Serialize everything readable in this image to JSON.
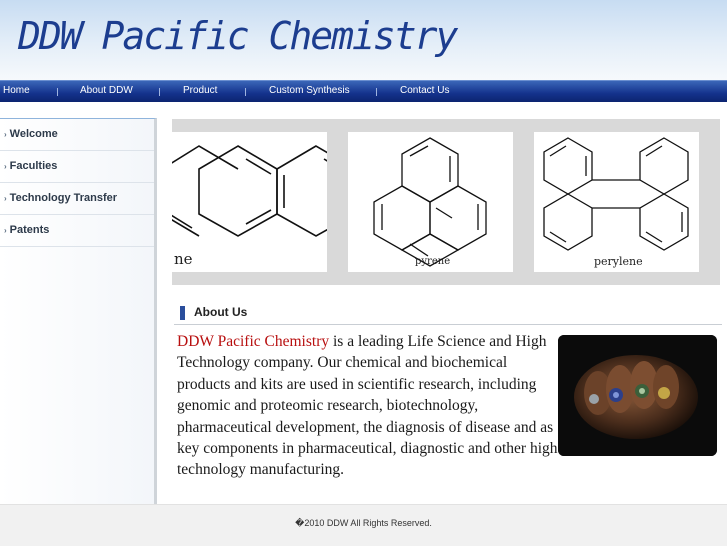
{
  "header": {
    "site_title": "DDW Pacific Chemistry"
  },
  "nav": {
    "items": [
      {
        "label": "Home"
      },
      {
        "label": "About DDW"
      },
      {
        "label": "Product"
      },
      {
        "label": "Custom Synthesis"
      },
      {
        "label": "Contact Us"
      }
    ]
  },
  "sidebar": {
    "items": [
      {
        "label": "Welcome"
      },
      {
        "label": "Faculties"
      },
      {
        "label": "Technology Transfer"
      },
      {
        "label": "Patents"
      }
    ]
  },
  "gallery": {
    "molecules": [
      {
        "name": "ne"
      },
      {
        "name": "pyrene"
      },
      {
        "name": "perylene"
      }
    ]
  },
  "about": {
    "title": "About Us",
    "company_name": "DDW Pacific Chemistry",
    "body": " is a leading Life Science and High Technology company. Our chemical and biochemical products and kits are used in scientific research, including genomic and proteomic research, biotechnology, pharmaceutical development, the diagnosis of disease and as key components in pharmaceutical, diagnostic and other high technology manufacturing."
  },
  "footer": {
    "copyright": "�2010 DDW All Rights Reserved."
  },
  "colors": {
    "brand_blue": "#1c3d8f",
    "nav_blue": "#14328c",
    "company_red": "#b80f0f"
  }
}
